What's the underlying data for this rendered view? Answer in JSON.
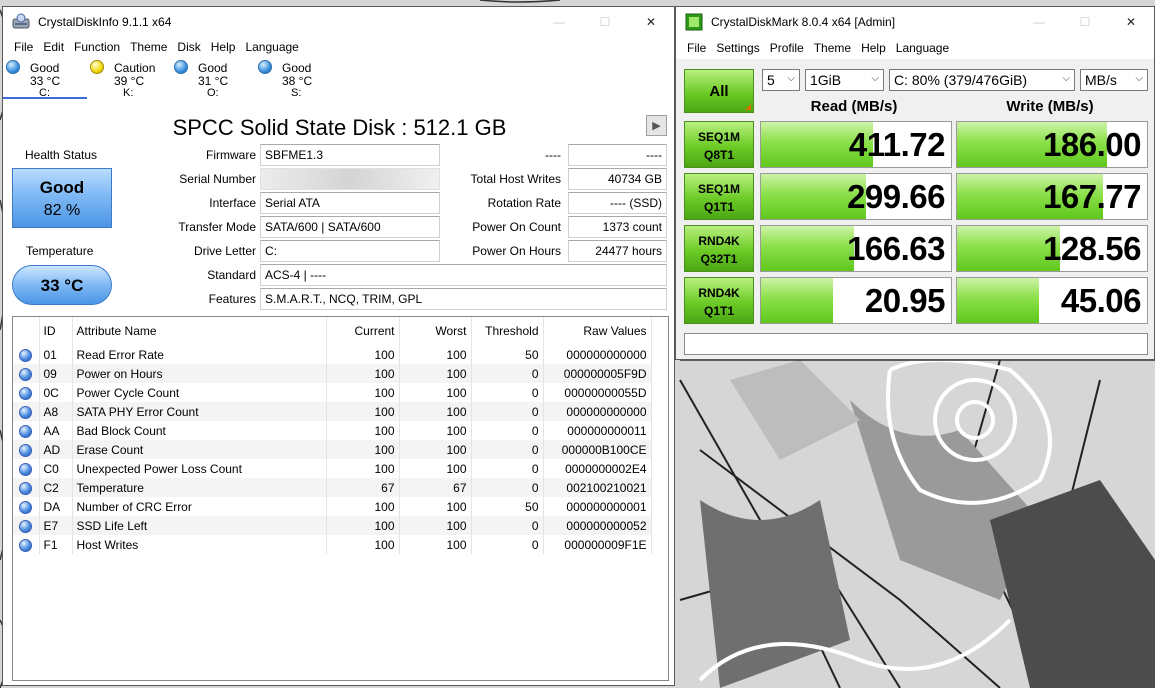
{
  "cdi": {
    "title": "CrystalDiskInfo 9.1.1 x64",
    "menu": [
      "File",
      "Edit",
      "Function",
      "Theme",
      "Disk",
      "Help",
      "Language"
    ],
    "disks": [
      {
        "status": "Good",
        "temp": "33 °C",
        "letter": "C:",
        "color": "blue"
      },
      {
        "status": "Caution",
        "temp": "39 °C",
        "letter": "K:",
        "color": "yellow"
      },
      {
        "status": "Good",
        "temp": "31 °C",
        "letter": "O:",
        "color": "blue"
      },
      {
        "status": "Good",
        "temp": "38 °C",
        "letter": "S:",
        "color": "blue"
      }
    ],
    "drive_title": "SPCC Solid State Disk : 512.1 GB",
    "health_label": "Health Status",
    "health_status": "Good",
    "health_percent": "82 %",
    "temperature_label": "Temperature",
    "temperature_value": "33 °C",
    "labels": {
      "firmware": "Firmware",
      "serial": "Serial Number",
      "interface": "Interface",
      "transfer": "Transfer Mode",
      "drive_letter": "Drive Letter",
      "standard": "Standard",
      "features": "Features",
      "unknown": "----",
      "host_writes": "Total Host Writes",
      "rotation": "Rotation Rate",
      "power_count": "Power On Count",
      "power_hours": "Power On Hours"
    },
    "values": {
      "firmware": "SBFME1.3",
      "serial": "",
      "interface": "Serial ATA",
      "transfer": "SATA/600 | SATA/600",
      "drive_letter": "C:",
      "standard": "ACS-4 | ----",
      "features": "S.M.A.R.T., NCQ, TRIM, GPL",
      "unknown": "----",
      "host_writes": "40734 GB",
      "rotation": "---- (SSD)",
      "power_count": "1373 count",
      "power_hours": "24477 hours"
    },
    "smart_headers": [
      "ID",
      "Attribute Name",
      "Current",
      "Worst",
      "Threshold",
      "Raw Values"
    ],
    "smart_rows": [
      [
        "01",
        "Read Error Rate",
        "100",
        "100",
        "50",
        "000000000000"
      ],
      [
        "09",
        "Power on Hours",
        "100",
        "100",
        "0",
        "000000005F9D"
      ],
      [
        "0C",
        "Power Cycle Count",
        "100",
        "100",
        "0",
        "00000000055D"
      ],
      [
        "A8",
        "SATA PHY Error Count",
        "100",
        "100",
        "0",
        "000000000000"
      ],
      [
        "AA",
        "Bad Block Count",
        "100",
        "100",
        "0",
        "000000000011"
      ],
      [
        "AD",
        "Erase Count",
        "100",
        "100",
        "0",
        "000000B100CE"
      ],
      [
        "C0",
        "Unexpected Power Loss Count",
        "100",
        "100",
        "0",
        "0000000002E4"
      ],
      [
        "C2",
        "Temperature",
        "67",
        "67",
        "0",
        "002100210021"
      ],
      [
        "DA",
        "Number of CRC Error",
        "100",
        "100",
        "50",
        "000000000001"
      ],
      [
        "E7",
        "SSD Life Left",
        "100",
        "100",
        "0",
        "000000000052"
      ],
      [
        "F1",
        "Host Writes",
        "100",
        "100",
        "0",
        "000000009F1E"
      ]
    ]
  },
  "cdm": {
    "title": "CrystalDiskMark 8.0.4 x64 [Admin]",
    "menu": [
      "File",
      "Settings",
      "Profile",
      "Theme",
      "Help",
      "Language"
    ],
    "all_label": "All",
    "count": "5",
    "size": "1GiB",
    "drive": "C: 80% (379/476GiB)",
    "unit": "MB/s",
    "read_header": "Read (MB/s)",
    "write_header": "Write (MB/s)",
    "tests": [
      {
        "line1": "SEQ1M",
        "line2": "Q8T1",
        "read": "411.72",
        "write": "186.00",
        "read_level": 0.59,
        "write_level": 0.79
      },
      {
        "line1": "SEQ1M",
        "line2": "Q1T1",
        "read": "299.66",
        "write": "167.77",
        "read_level": 0.55,
        "write_level": 0.77
      },
      {
        "line1": "RND4K",
        "line2": "Q32T1",
        "read": "166.63",
        "write": "128.56",
        "read_level": 0.49,
        "write_level": 0.54
      },
      {
        "line1": "RND4K",
        "line2": "Q1T1",
        "read": "20.95",
        "write": "45.06",
        "read_level": 0.38,
        "write_level": 0.43
      }
    ],
    "comment": ""
  },
  "colors": {
    "accent_green": "#6ccb26",
    "health_blue": "#4b95e6",
    "tab_underline": "#3d6bdc"
  }
}
